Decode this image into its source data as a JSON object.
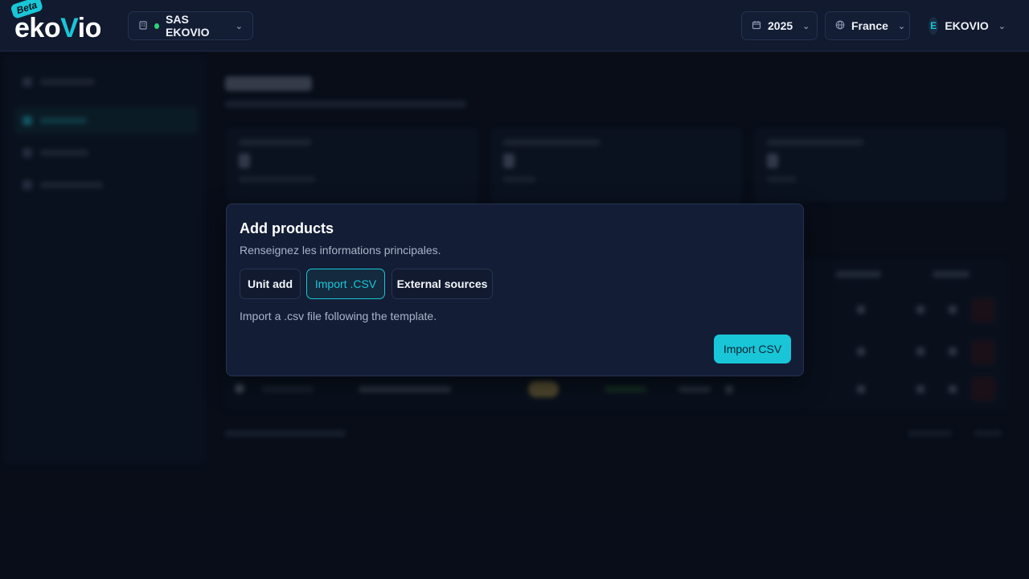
{
  "header": {
    "logo_text_1": "eko",
    "logo_text_2": "V",
    "logo_text_3": "io",
    "beta_badge": "Beta",
    "organization": "SAS EKOVIO",
    "year": "2025",
    "country": "France",
    "user_initial": "E",
    "user_name": "EKOVIO"
  },
  "modal": {
    "title": "Add products",
    "subtitle": "Renseignez les informations principales.",
    "tabs": [
      {
        "label": "Unit add",
        "active": false
      },
      {
        "label": "Import .CSV",
        "active": true
      },
      {
        "label": "External sources",
        "active": false
      }
    ],
    "description": "Import a .csv file following the template.",
    "primary_button": "Import CSV"
  },
  "colors": {
    "accent": "#19c6d8",
    "status_online": "#2fd37a",
    "background": "#0b1220",
    "modal_bg": "#131d36"
  },
  "icons": {
    "organization": "building-icon",
    "calendar": "calendar-icon",
    "country": "globe-icon",
    "dropdown": "chevron-down-icon"
  }
}
